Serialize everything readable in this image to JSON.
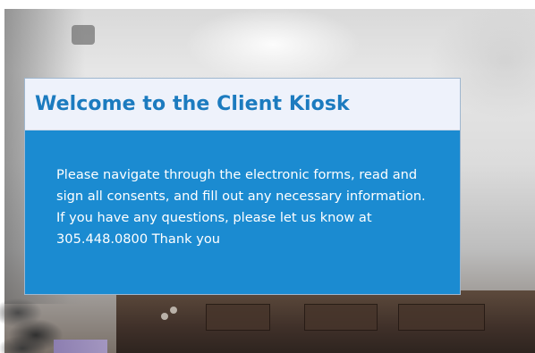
{
  "kiosk": {
    "title": "Welcome to the Client Kiosk",
    "message": "Please navigate through the electronic forms, read and sign all consents, and fill out any necessary information. If you have any questions, please let us know at 305.448.0800 Thank you"
  },
  "colors": {
    "header_background": "#eef2fb",
    "title_text": "#1c7bbf",
    "body_background": "#1b8bd1",
    "body_text": "#ffffff"
  }
}
